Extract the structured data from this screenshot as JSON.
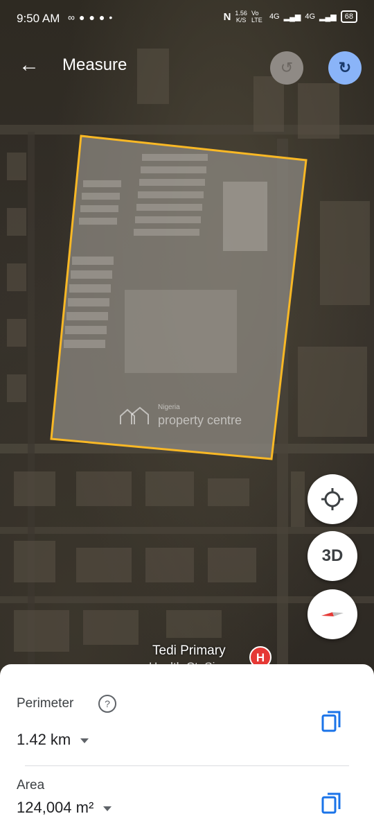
{
  "status_bar": {
    "time": "9:50 AM",
    "left_icons": [
      "voicemail-icon",
      "messenger-icon",
      "telegram-icon",
      "facebook-icon",
      "dot-icon"
    ],
    "speed_value": "1.56",
    "speed_unit": "K/S",
    "volte": "Vo LTE",
    "network1": "4G",
    "network2": "4G",
    "battery": "68"
  },
  "toolbar": {
    "title": "Measure",
    "back_icon": "arrow-left-icon",
    "undo_icon": "undo-icon",
    "redo_icon": "redo-icon"
  },
  "map": {
    "watermark_small": "Nigeria",
    "watermark_big": "property centre",
    "poi_name": "Tedi Primary",
    "poi_name_cont": "Health Ct. Si...",
    "poi_marker": "H",
    "polygon_color": "#f9b825",
    "buttons": {
      "locate_icon": "my-location-icon",
      "three_d_label": "3D",
      "compass_icon": "compass-icon"
    }
  },
  "measurement": {
    "perimeter_label": "Perimeter",
    "perimeter_value": "1.42 km",
    "area_label": "Area",
    "area_value": "124,004 m²",
    "help_icon": "question-icon",
    "copy_icon": "copy-icon"
  },
  "colors": {
    "accent": "#1a73e8",
    "redo_bg": "#8ab4f8"
  }
}
